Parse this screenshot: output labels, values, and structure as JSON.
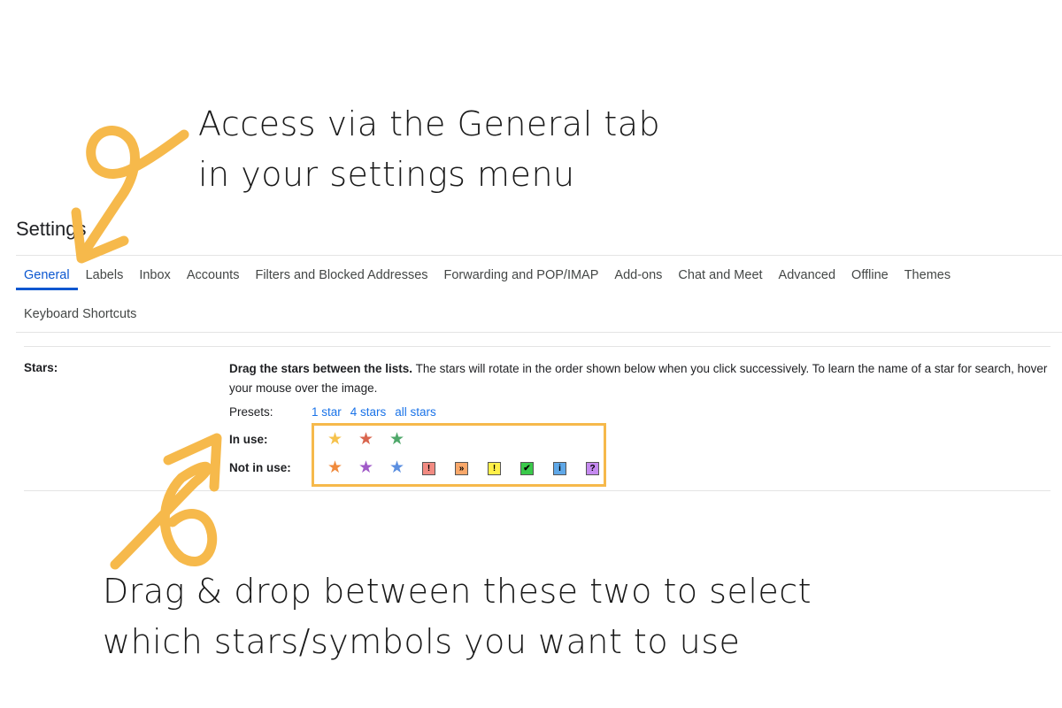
{
  "annotations": {
    "top_line1": "Access via the General tab",
    "top_line2": "in your settings menu",
    "bottom_line1": "Drag & drop between these two to select",
    "bottom_line2": "which stars/symbols you want to use",
    "color": "#f6b94b"
  },
  "settings": {
    "title": "Settings",
    "tabs": [
      {
        "label": "General",
        "active": true
      },
      {
        "label": "Labels"
      },
      {
        "label": "Inbox"
      },
      {
        "label": "Accounts"
      },
      {
        "label": "Filters and Blocked Addresses"
      },
      {
        "label": "Forwarding and POP/IMAP"
      },
      {
        "label": "Add-ons"
      },
      {
        "label": "Chat and Meet"
      },
      {
        "label": "Advanced"
      },
      {
        "label": "Offline"
      },
      {
        "label": "Themes"
      },
      {
        "label": "Keyboard Shortcuts"
      }
    ],
    "accent": "#0b57d0"
  },
  "stars": {
    "label": "Stars:",
    "desc_bold": "Drag the stars between the lists.",
    "desc_rest": " The stars will rotate in the order shown below when you click successively. To learn the name of a star for search, hover your mouse over the image.",
    "presets_label": "Presets:",
    "presets": [
      "1 star",
      "4 stars",
      "all stars"
    ],
    "in_use_label": "In use:",
    "not_in_use_label": "Not in use:",
    "in_use": [
      {
        "name": "yellow-star",
        "color": "#f6c24c"
      },
      {
        "name": "red-star",
        "color": "#d9654e"
      },
      {
        "name": "green-star",
        "color": "#4fa86a"
      }
    ],
    "not_in_use_stars": [
      {
        "name": "orange-star",
        "color": "#f08a3c"
      },
      {
        "name": "purple-star",
        "color": "#a05ac8"
      },
      {
        "name": "blue-star",
        "color": "#5b8fe0"
      }
    ],
    "not_in_use_symbols": [
      {
        "name": "red-bang",
        "glyph": "!",
        "bg": "#f28b82"
      },
      {
        "name": "orange-guillemet",
        "glyph": "»",
        "bg": "#f9a86a"
      },
      {
        "name": "yellow-bang",
        "glyph": "!",
        "bg": "#fff04a"
      },
      {
        "name": "green-check",
        "glyph": "✔",
        "bg": "#3ac94a"
      },
      {
        "name": "blue-info",
        "glyph": "i",
        "bg": "#5fa8e8"
      },
      {
        "name": "purple-question",
        "glyph": "?",
        "bg": "#c58af0"
      }
    ]
  }
}
